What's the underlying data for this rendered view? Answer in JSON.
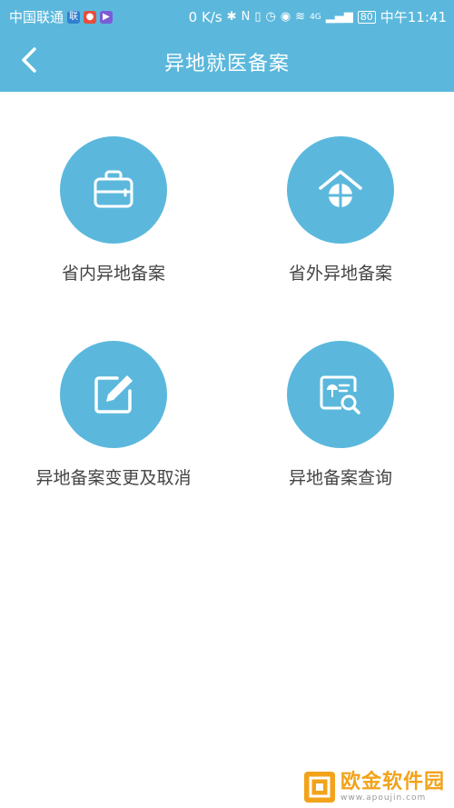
{
  "status_bar": {
    "carrier": "中国联通",
    "speed": "0 K/s",
    "network": "4G",
    "battery": "80",
    "time": "中午11:41"
  },
  "header": {
    "title": "异地就医备案"
  },
  "menu": {
    "items": [
      {
        "label": "省内异地备案",
        "icon": "briefcase-icon"
      },
      {
        "label": "省外异地备案",
        "icon": "house-icon"
      },
      {
        "label": "异地备案变更及取消",
        "icon": "edit-icon"
      },
      {
        "label": "异地备案查询",
        "icon": "search-document-icon"
      }
    ]
  },
  "watermark": {
    "name": "欧金软件园",
    "url": "www.apoujin.com"
  },
  "colors": {
    "primary": "#5bb8dc",
    "text": "#444444",
    "watermark": "#f2a31a"
  }
}
